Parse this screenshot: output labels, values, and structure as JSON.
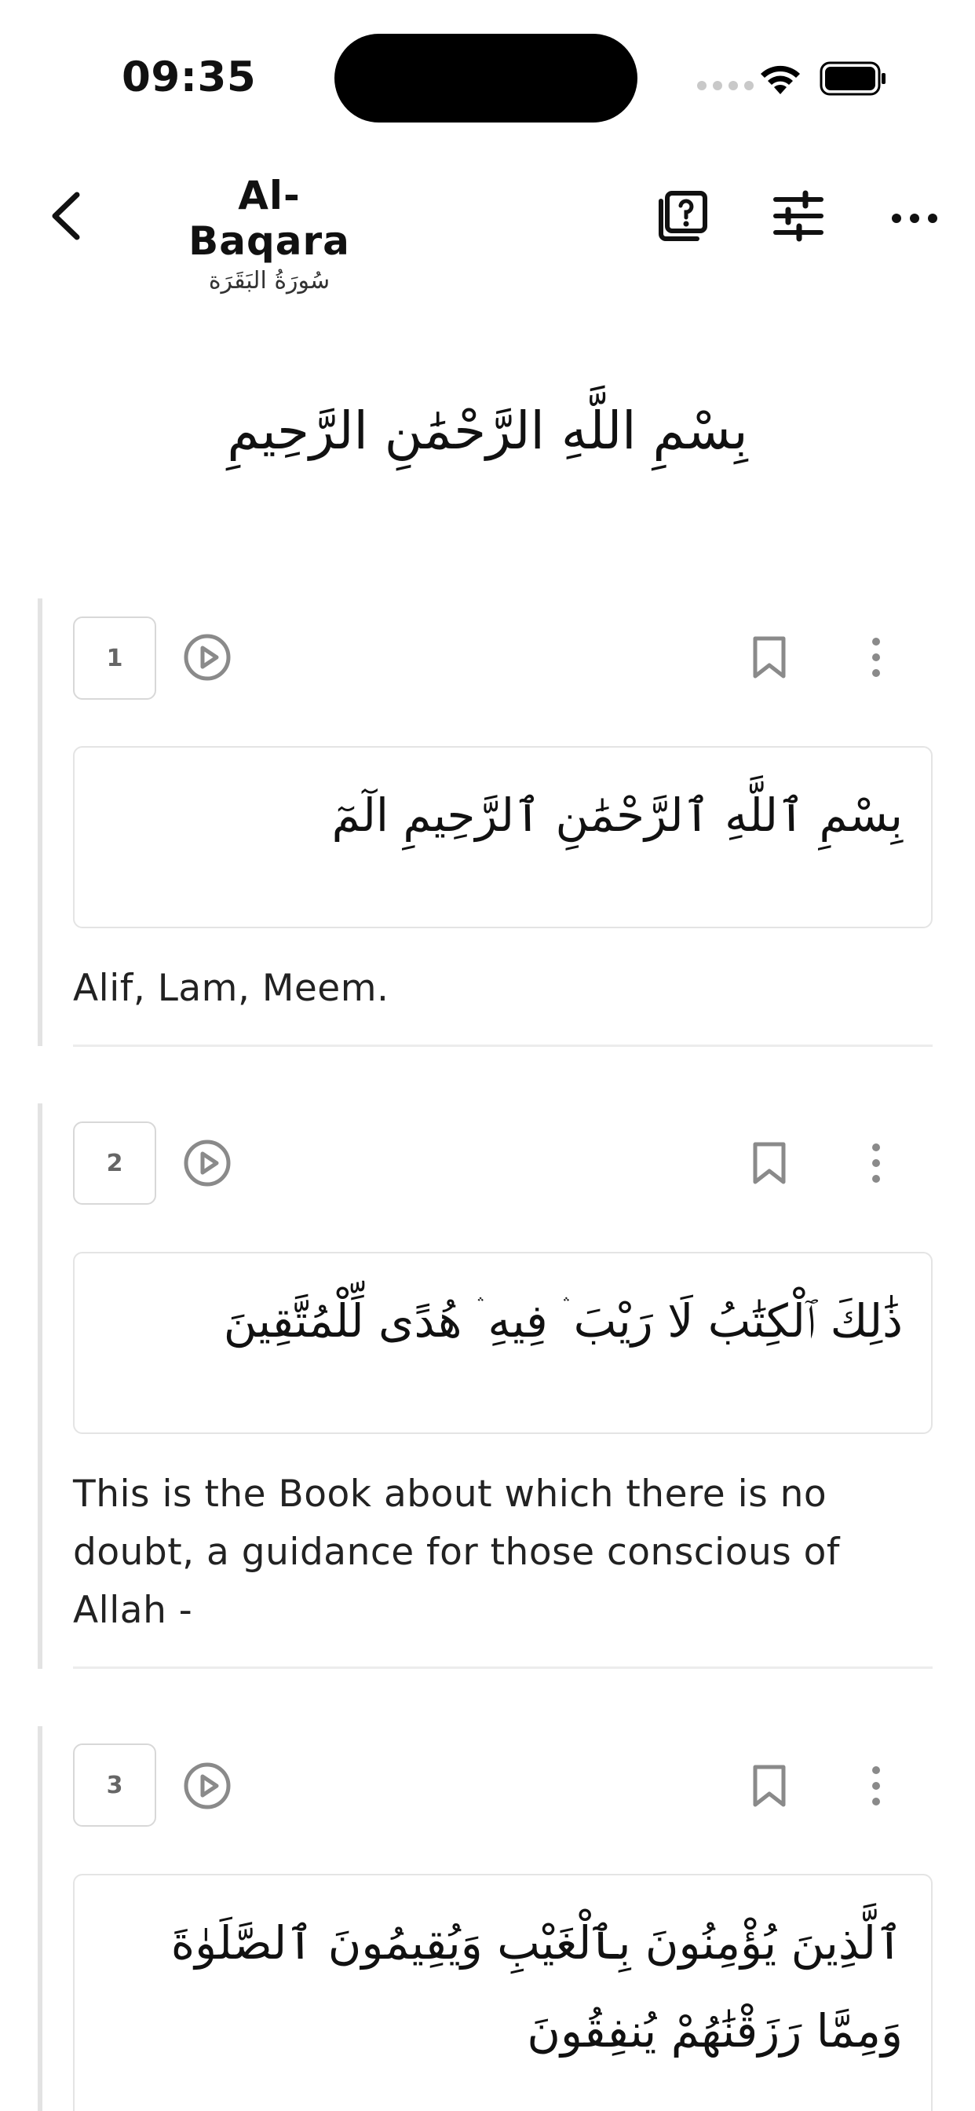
{
  "status_bar": {
    "time": "09:35"
  },
  "header": {
    "title": "Al-Baqara",
    "subtitle": "سُورَةُ البَقَرَة"
  },
  "bismillah": "بِسْمِ اللَّهِ الرَّحْمَٰنِ الرَّحِيمِ",
  "verses": [
    {
      "number": "1",
      "arabic": "بِسْمِ ٱللَّهِ ٱلرَّحْمَٰنِ ٱلرَّحِيمِ الٓمٓ",
      "translation": "Alif, Lam, Meem."
    },
    {
      "number": "2",
      "arabic": "ذَٰلِكَ ٱلْكِتَٰبُ لَا رَيْبَ ۛ فِيهِ ۛ هُدًى لِّلْمُتَّقِينَ",
      "translation": "This is the Book about which there is no doubt, a guidance for those conscious of Allah -"
    },
    {
      "number": "3",
      "arabic": "ٱلَّذِينَ يُؤْمِنُونَ بِٱلْغَيْبِ وَيُقِيمُونَ ٱلصَّلَوٰةَ وَمِمَّا رَزَقْنَٰهُمْ يُنفِقُونَ",
      "translation": ""
    }
  ],
  "icons": {
    "back": "chevron-left-icon",
    "help": "help-square-icon",
    "settings": "sliders-icon",
    "more": "more-horizontal-icon",
    "play": "play-circle-icon",
    "bookmark": "bookmark-icon",
    "verse_more": "more-vertical-icon"
  },
  "colors": {
    "accent_gray": "#8a8a8a",
    "border": "#e4e4e4"
  }
}
